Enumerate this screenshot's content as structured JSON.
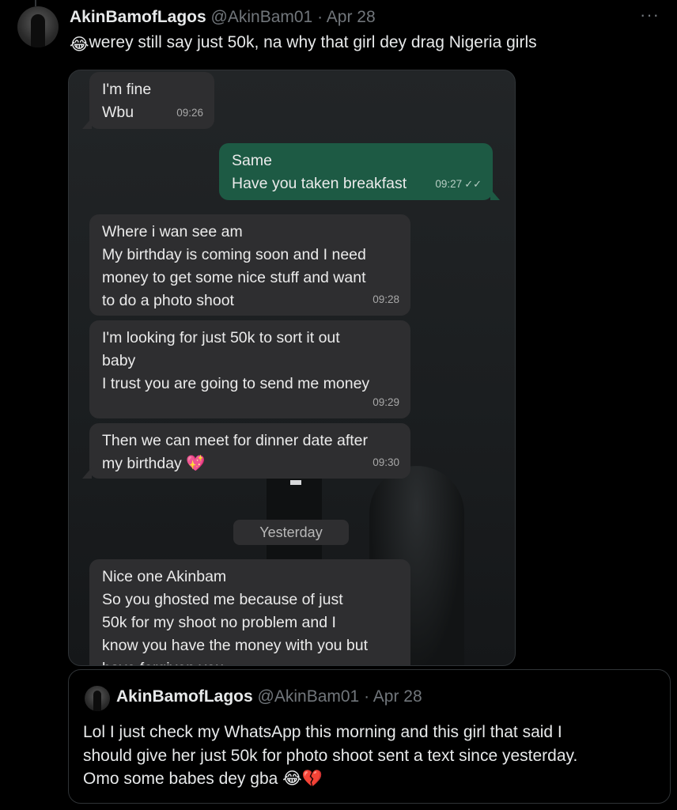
{
  "tweet": {
    "name": "AkinBamofLagos",
    "handle": "@AkinBam01",
    "separator": " · ",
    "date": "Apr 28",
    "more": "···",
    "text": "werey still say just 50k, na why that girl dey drag Nigeria girls",
    "leading_emoji": "😂"
  },
  "chat": {
    "messages": [
      {
        "direction": "incoming",
        "lines": [
          "I'm fine",
          "Wbu"
        ],
        "time": "09:26"
      },
      {
        "direction": "outgoing",
        "lines": [
          "Same",
          "Have you taken breakfast"
        ],
        "time": "09:27",
        "ticks": "✓✓"
      },
      {
        "direction": "incoming",
        "lines": [
          "Where i wan see am",
          "My birthday is coming soon and I need",
          "money to get some nice stuff and want",
          "to do a photo shoot"
        ],
        "time": "09:28"
      },
      {
        "direction": "incoming",
        "lines": [
          "I'm looking for just 50k to sort it out",
          "baby",
          "I trust you are going to send me money"
        ],
        "time": "09:29"
      },
      {
        "direction": "incoming",
        "lines": [
          "Then we can meet for dinner date after",
          "my birthday 💖"
        ],
        "time": "09:30"
      },
      {
        "direction": "incoming",
        "lines": [
          "Nice one Akinbam",
          "So you ghosted me because of just",
          "50k for my shoot no problem and I",
          "know you have the money with you but",
          "have forgiven you"
        ]
      }
    ],
    "date_divider": "Yesterday"
  },
  "quote": {
    "name": "AkinBamofLagos",
    "handle": "@AkinBam01",
    "separator": " · ",
    "date": "Apr 28",
    "lines": [
      "Lol I just check my WhatsApp this morning and this girl that said I",
      "should give her just 50k for photo shoot sent a text since yesterday.",
      "Omo some babes dey gba 😂💔"
    ]
  },
  "colors": {
    "background": "#000000",
    "incoming_bubble": "#2e2e30",
    "outgoing_bubble": "#1d5a44",
    "muted_text": "#71767b",
    "border": "#2f3336"
  }
}
